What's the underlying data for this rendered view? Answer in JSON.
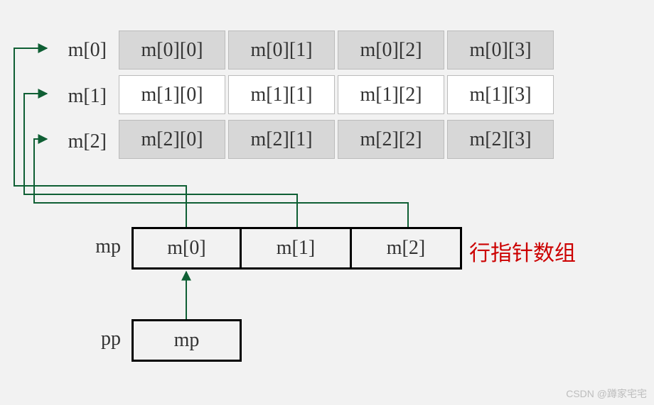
{
  "array": {
    "rows": [
      {
        "label": "m[0]",
        "cells": [
          "m[0][0]",
          "m[0][1]",
          "m[0][2]",
          "m[0][3]"
        ]
      },
      {
        "label": "m[1]",
        "cells": [
          "m[1][0]",
          "m[1][1]",
          "m[1][2]",
          "m[1][3]"
        ]
      },
      {
        "label": "m[2]",
        "cells": [
          "m[2][0]",
          "m[2][1]",
          "m[2][2]",
          "m[2][3]"
        ]
      }
    ]
  },
  "mp": {
    "label": "mp",
    "cells": [
      "m[0]",
      "m[1]",
      "m[2]"
    ],
    "annotation": "行指针数组"
  },
  "pp": {
    "label": "pp",
    "value": "mp"
  },
  "watermark": "CSDN @蹲家宅宅",
  "colors": {
    "arrow": "#0f5f34",
    "annotation": "#cc0000"
  }
}
